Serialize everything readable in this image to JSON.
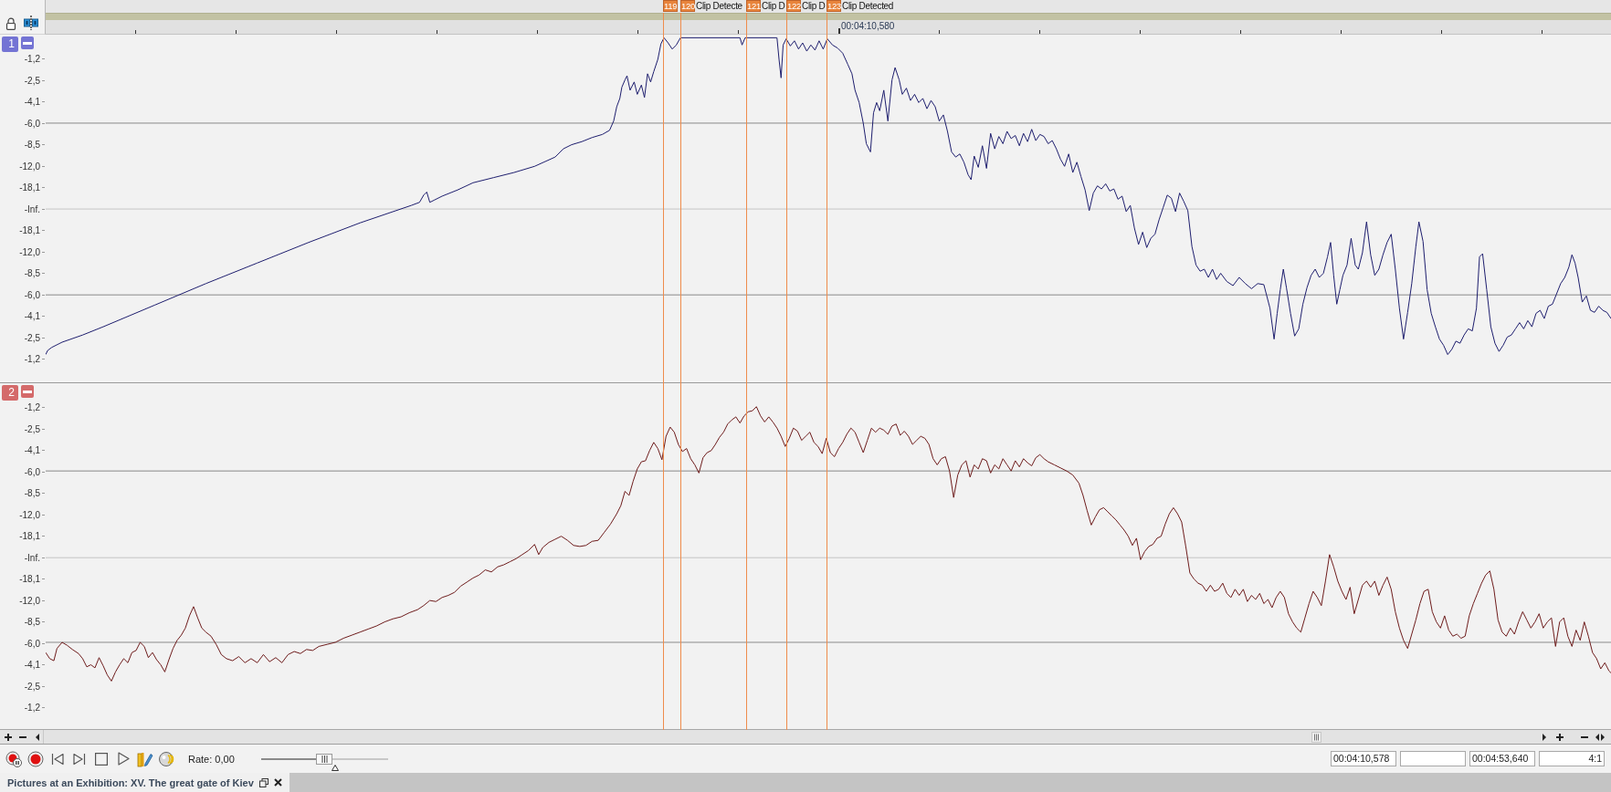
{
  "header": {
    "markers": [
      {
        "number": "119"
      },
      {
        "number": "120",
        "label": "Clip Detecte"
      },
      {
        "number": "121",
        "label": "Clip D"
      },
      {
        "number": "122",
        "label": "Clip D"
      },
      {
        "number": "123",
        "label": "Clip Detected"
      }
    ],
    "cursor_time": "00:04:10,580"
  },
  "tracks": [
    {
      "number": "1",
      "color": "#7474d4",
      "scale": [
        "-1,2",
        "-2,5",
        "-4,1",
        "-6,0",
        "-8,5",
        "-12,0",
        "-18,1",
        "-Inf.",
        "-18,1",
        "-12,0",
        "-8,5",
        "-6,0",
        "-4,1",
        "-2,5",
        "-1,2"
      ]
    },
    {
      "number": "2",
      "color": "#d46a6a",
      "scale": [
        "-1,2",
        "-2,5",
        "-4,1",
        "-6,0",
        "-8,5",
        "-12,0",
        "-18,1",
        "-Inf.",
        "-18,1",
        "-12,0",
        "-8,5",
        "-6,0",
        "-4,1",
        "-2,5",
        "-1,2"
      ]
    }
  ],
  "transport": {
    "rate": "Rate: 0,00",
    "rate_slider": {
      "level": 0.5
    }
  },
  "status_fields": [
    {
      "kind": "time",
      "value": "00:04:10,578"
    },
    {
      "kind": "time"
    },
    {
      "kind": "time",
      "value": "00:04:53,640"
    },
    {
      "kind": "ratio",
      "value": "4:1"
    }
  ],
  "document_tab": {
    "title": "Pictures at an Exhibition: XV. The great gate of Kiev"
  }
}
